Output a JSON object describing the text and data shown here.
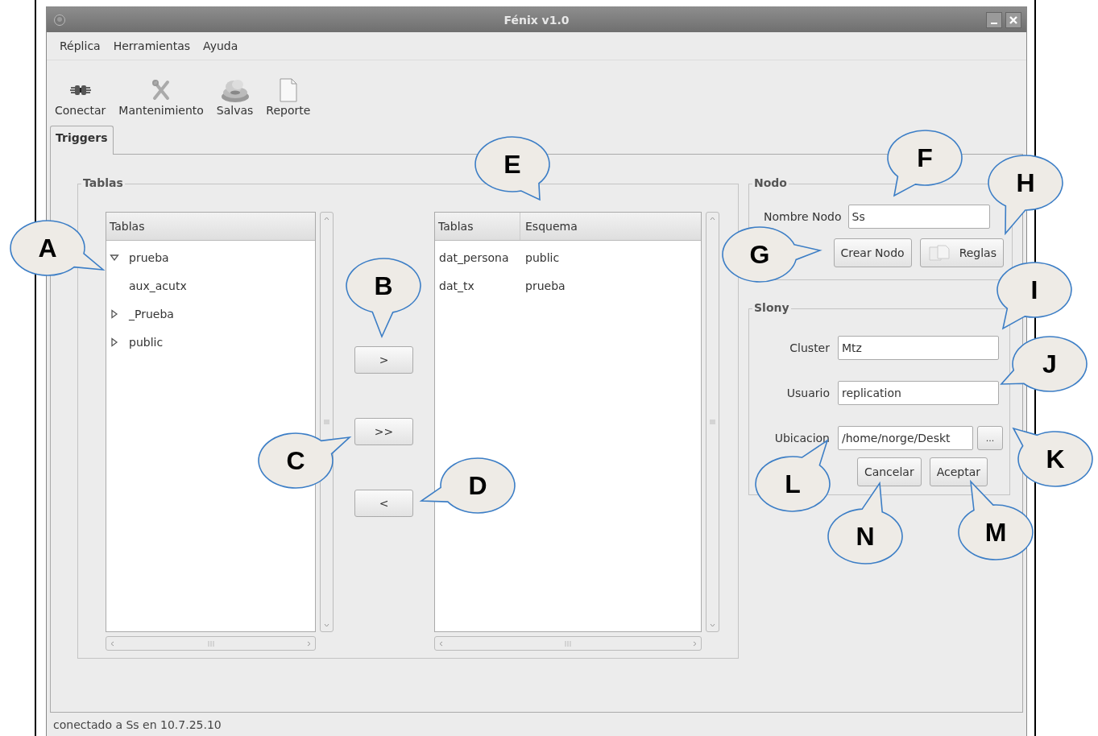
{
  "window": {
    "title": "Fénix v1.0"
  },
  "menu": [
    {
      "label": "Réplica"
    },
    {
      "label": "Herramientas"
    },
    {
      "label": "Ayuda"
    }
  ],
  "toolbar": [
    {
      "label": "Conectar"
    },
    {
      "label": "Mantenimiento"
    },
    {
      "label": "Salvas"
    },
    {
      "label": "Reporte"
    }
  ],
  "tabs": [
    {
      "label": "Triggers",
      "selected": true
    }
  ],
  "tables_frame": {
    "title": "Tablas",
    "tree": {
      "column": "Tablas",
      "items": [
        {
          "label": "prueba",
          "expanded": true,
          "children": [
            {
              "label": "aux_acutx"
            }
          ]
        },
        {
          "label": "_Prueba",
          "expanded": false
        },
        {
          "label": "public",
          "expanded": false
        }
      ]
    },
    "buttons": [
      ">",
      ">>",
      "<"
    ],
    "selected_list": {
      "columns": [
        "Tablas",
        "Esquema"
      ],
      "rows": [
        [
          "dat_persona",
          "public"
        ],
        [
          "dat_tx",
          "prueba"
        ]
      ]
    }
  },
  "nodo": {
    "title": "Nodo",
    "fields": [
      {
        "label": "Nombre Nodo",
        "value": "Ss"
      }
    ],
    "buttons": [
      "Crear Nodo",
      "Reglas"
    ]
  },
  "slony": {
    "title": "Slony",
    "fields": [
      {
        "label": "Cluster",
        "value": "Mtz"
      },
      {
        "label": "Usuario",
        "value": "replication"
      },
      {
        "label": "Ubicacion",
        "value": "/home/norge/Deskt"
      }
    ],
    "browse_button": "...",
    "buttons": [
      "Cancelar",
      "Aceptar"
    ]
  },
  "status_bar": "conectado a Ss en 10.7.25.10",
  "callouts": [
    {
      "label": "A"
    },
    {
      "label": "B"
    },
    {
      "label": "C"
    },
    {
      "label": "D"
    },
    {
      "label": "E"
    },
    {
      "label": "F"
    },
    {
      "label": "G"
    },
    {
      "label": "H"
    },
    {
      "label": "I"
    },
    {
      "label": "J"
    },
    {
      "label": "K"
    },
    {
      "label": "L"
    },
    {
      "label": "M"
    },
    {
      "label": "N"
    }
  ]
}
